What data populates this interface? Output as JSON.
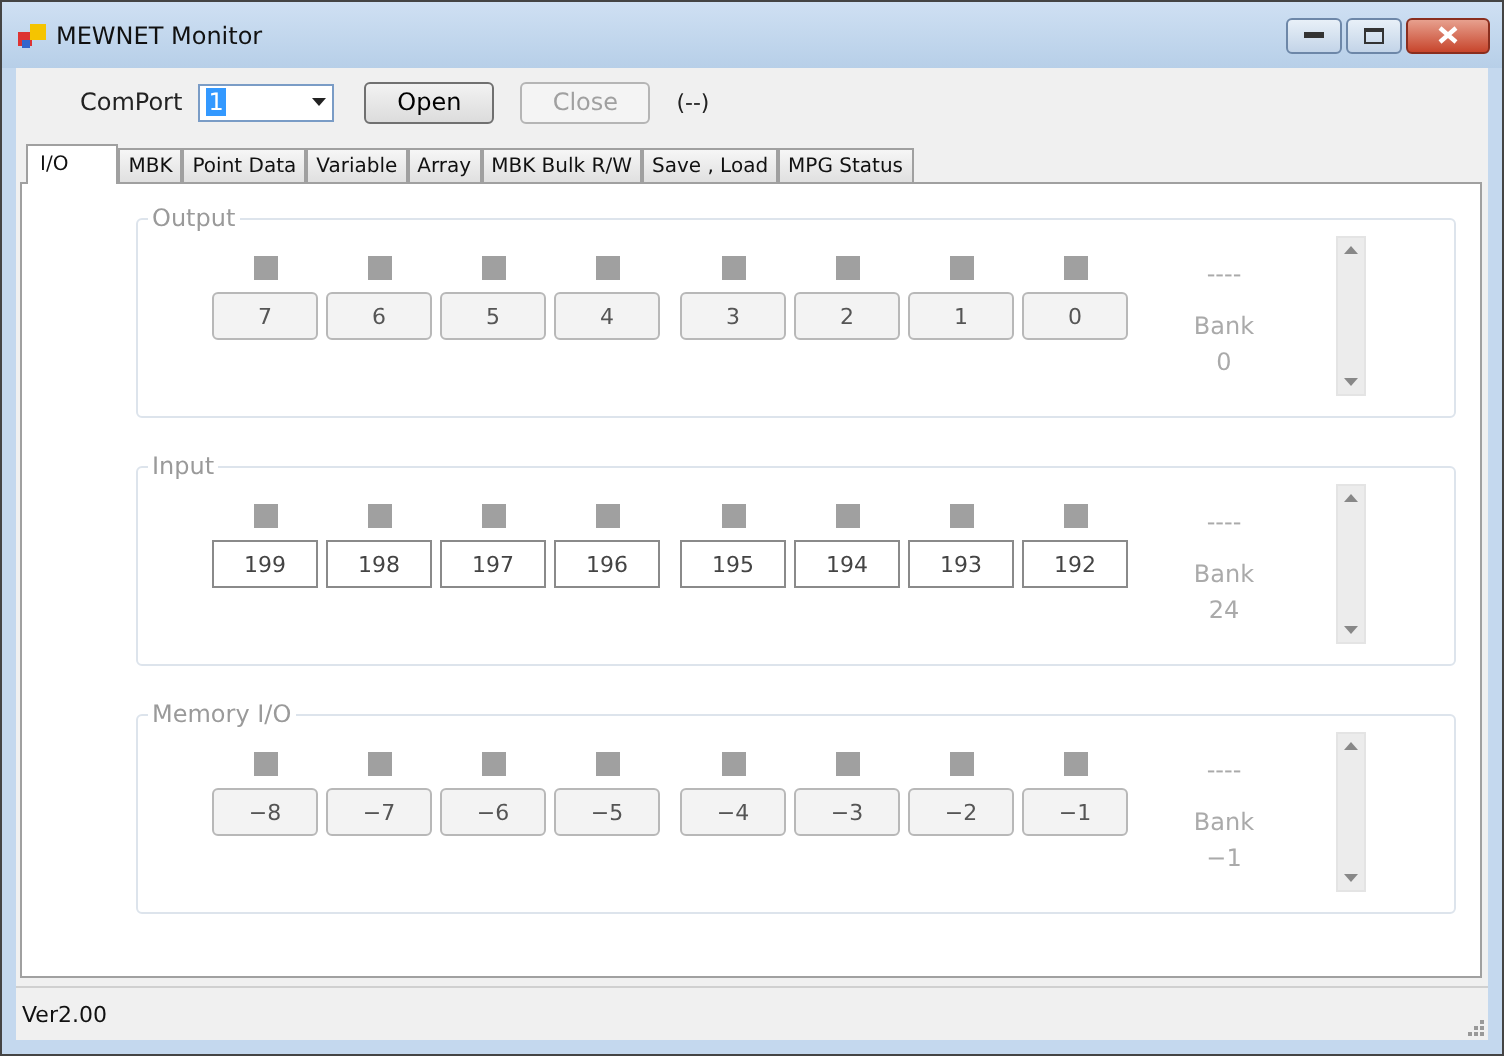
{
  "window": {
    "title": "MEWNET Monitor"
  },
  "toolbar": {
    "port_label": "ComPort",
    "port_value": "1",
    "open_button": {
      "label": "Open",
      "disabled": false
    },
    "close_button": {
      "label": "Close",
      "disabled": true
    },
    "status": "(--)"
  },
  "tabs": [
    {
      "label": "I/O",
      "selected": true
    },
    {
      "label": "MBK",
      "selected": false
    },
    {
      "label": "Point Data",
      "selected": false
    },
    {
      "label": "Variable",
      "selected": false
    },
    {
      "label": "Array",
      "selected": false
    },
    {
      "label": "MBK Bulk R/W",
      "selected": false
    },
    {
      "label": "Save , Load",
      "selected": false
    },
    {
      "label": "MPG Status",
      "selected": false
    }
  ],
  "groups": [
    {
      "title": "Output",
      "disabled": true,
      "value": "----",
      "bank_label": "Bank",
      "bank": "0",
      "bits": [
        {
          "label": "7",
          "on": false
        },
        {
          "label": "6",
          "on": false
        },
        {
          "label": "5",
          "on": false
        },
        {
          "label": "4",
          "on": false
        },
        {
          "label": "3",
          "on": false
        },
        {
          "label": "2",
          "on": false
        },
        {
          "label": "1",
          "on": false
        },
        {
          "label": "0",
          "on": false
        }
      ]
    },
    {
      "title": "Input",
      "disabled": false,
      "value": "----",
      "bank_label": "Bank",
      "bank": "24",
      "bits": [
        {
          "label": "199",
          "on": false
        },
        {
          "label": "198",
          "on": false
        },
        {
          "label": "197",
          "on": false
        },
        {
          "label": "196",
          "on": false
        },
        {
          "label": "195",
          "on": false
        },
        {
          "label": "194",
          "on": false
        },
        {
          "label": "193",
          "on": false
        },
        {
          "label": "192",
          "on": false
        }
      ]
    },
    {
      "title": "Memory I/O",
      "disabled": true,
      "value": "----",
      "bank_label": "Bank",
      "bank": "−1",
      "bits": [
        {
          "label": "−8",
          "on": false
        },
        {
          "label": "−7",
          "on": false
        },
        {
          "label": "−6",
          "on": false
        },
        {
          "label": "−5",
          "on": false
        },
        {
          "label": "−4",
          "on": false
        },
        {
          "label": "−3",
          "on": false
        },
        {
          "label": "−2",
          "on": false
        },
        {
          "label": "−1",
          "on": false
        }
      ]
    }
  ],
  "status_bar": {
    "text": "Ver2.00"
  }
}
